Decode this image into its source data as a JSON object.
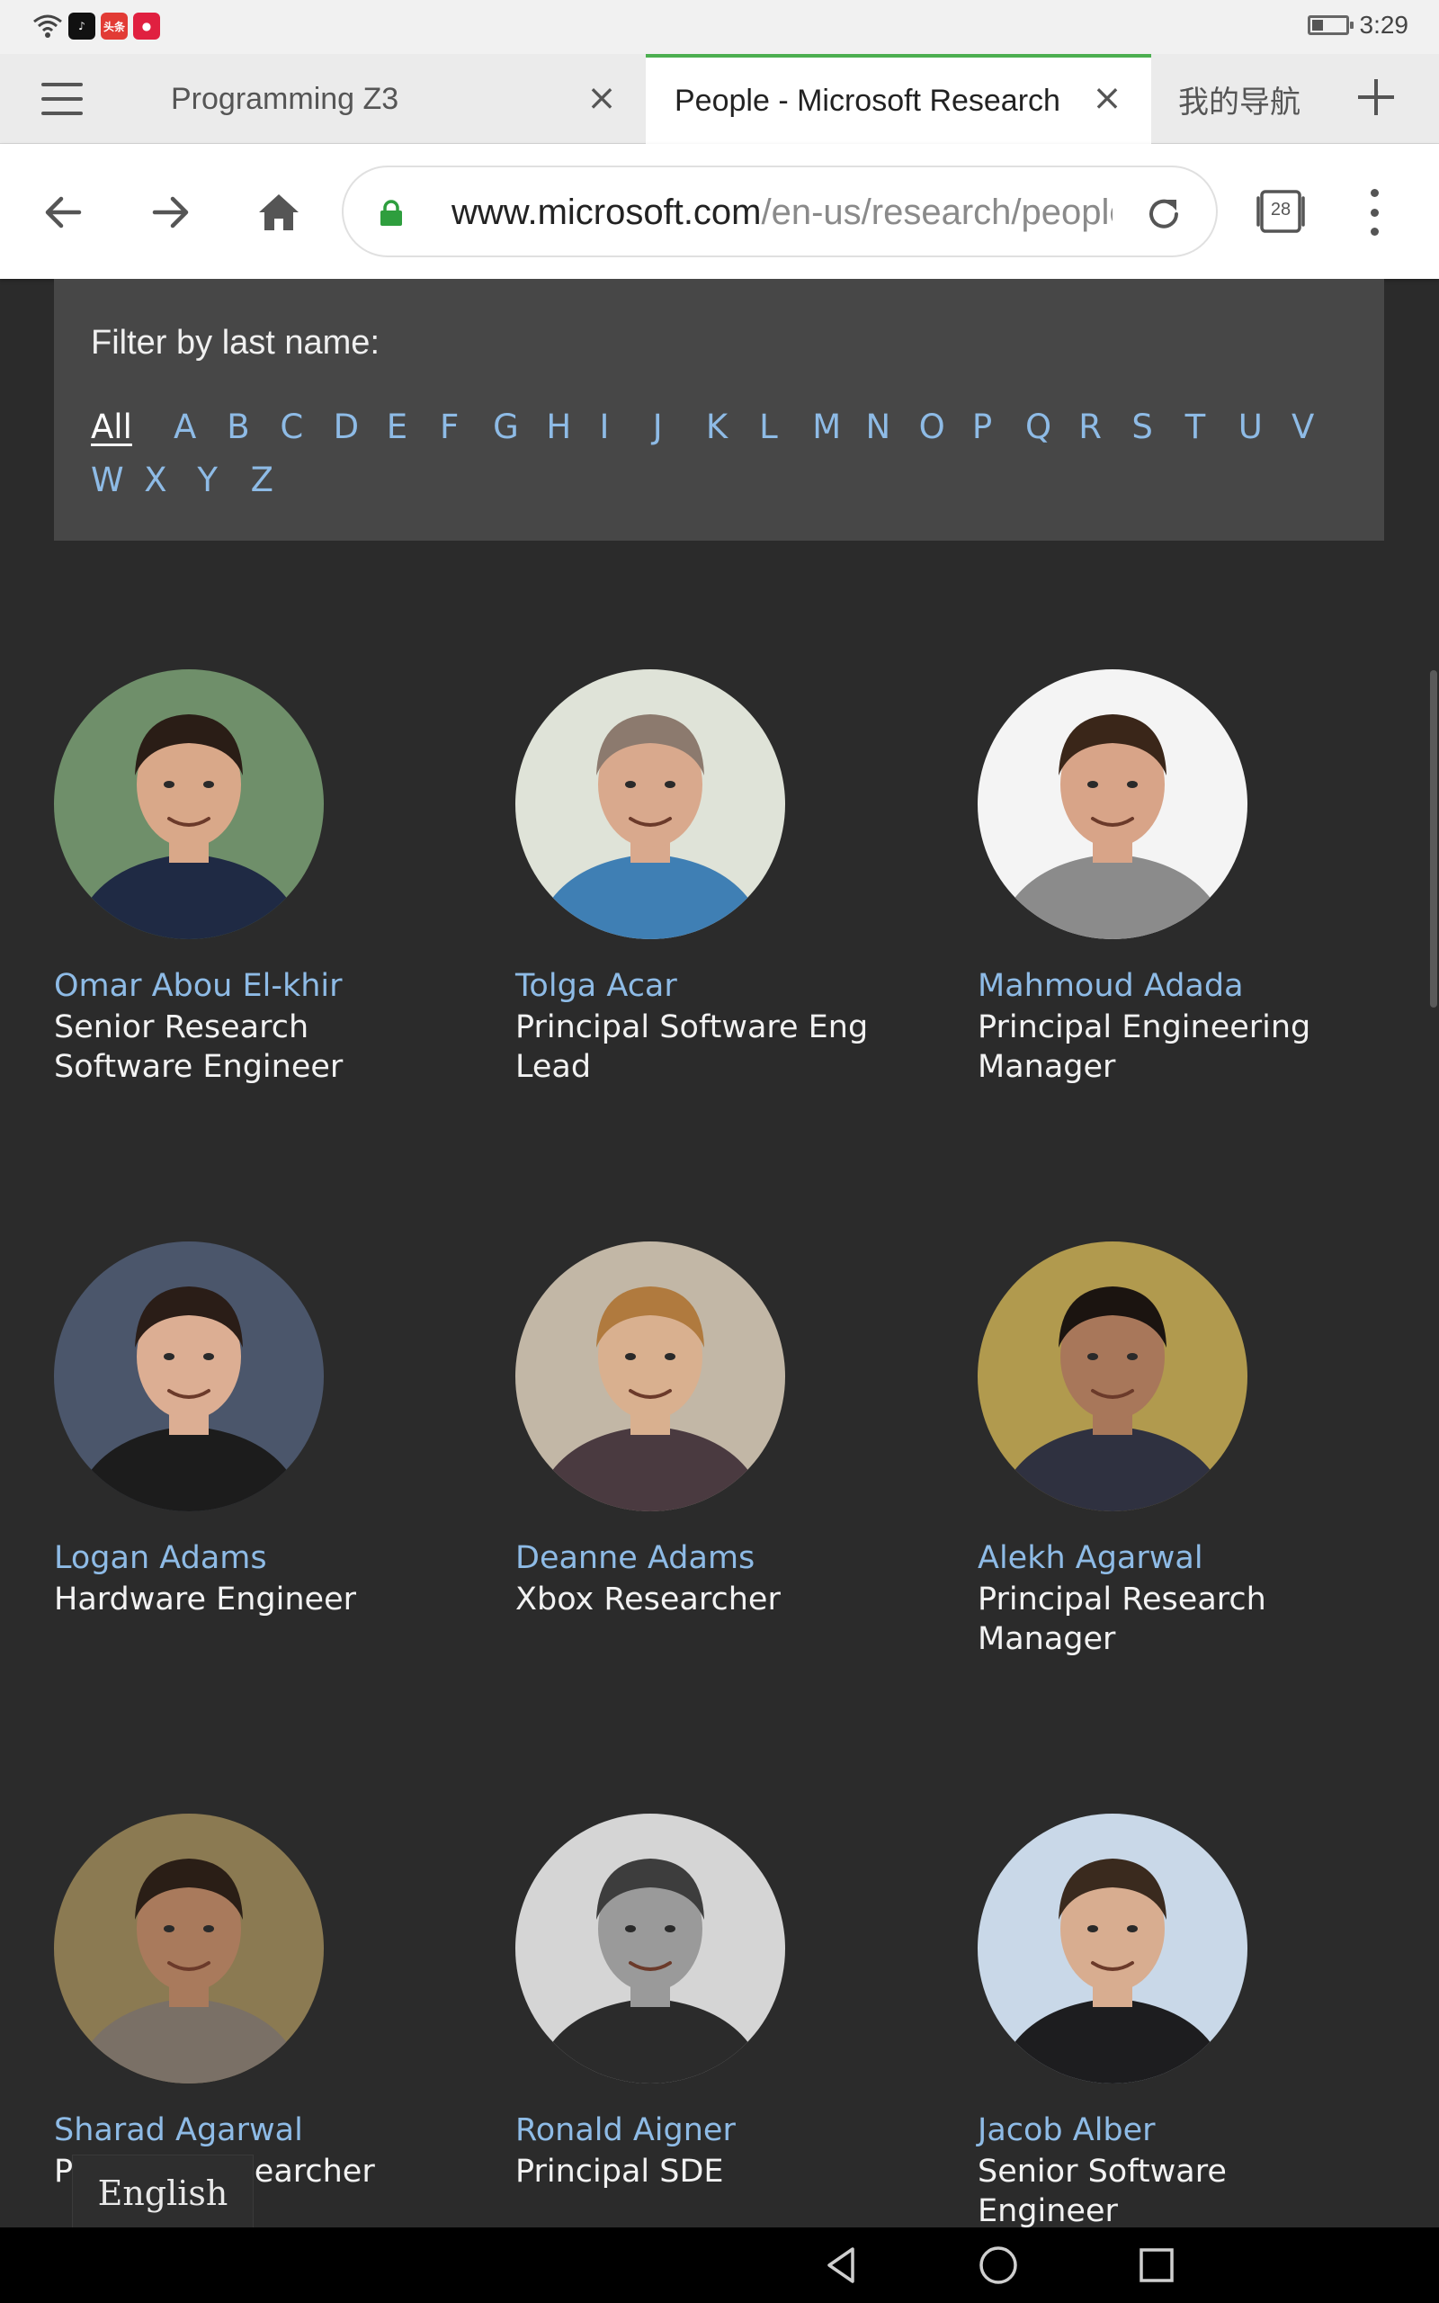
{
  "status_bar": {
    "time": "3:29",
    "apps": [
      {
        "name": "tiktok-app-icon",
        "label": "♪",
        "color": "#111111"
      },
      {
        "name": "toutiao-app-icon",
        "label": "头条",
        "color": "#e23b35"
      },
      {
        "name": "red-app-icon",
        "label": "●",
        "color": "#e02040"
      }
    ]
  },
  "browser": {
    "tabs": [
      {
        "label": "Programming Z3",
        "active": false
      },
      {
        "label": "People - Microsoft Research",
        "active": true
      },
      {
        "label": "我的导航",
        "active": false
      }
    ],
    "url_host": "www.microsoft.com",
    "url_path": "/en-us/research/people/",
    "tab_count": "28"
  },
  "filter": {
    "title": "Filter by last name:",
    "all_label": "All",
    "letters": [
      "A",
      "B",
      "C",
      "D",
      "E",
      "F",
      "G",
      "H",
      "I",
      "J",
      "K",
      "L",
      "M",
      "N",
      "O",
      "P",
      "Q",
      "R",
      "S",
      "T",
      "U",
      "V",
      "W",
      "X",
      "Y",
      "Z"
    ]
  },
  "people": [
    {
      "name": "Omar Abou El-khir",
      "title": "Senior Research Software Engineer",
      "skin": "#d9a889",
      "hair": "#2a1d16",
      "shirt": "#1f2a44",
      "bg": "#6f8f6a"
    },
    {
      "name": "Tolga Acar",
      "title": "Principal Software Eng Lead",
      "skin": "#d9a98d",
      "hair": "#8c7a6e",
      "shirt": "#3f7fb4",
      "bg": "#dfe3d8"
    },
    {
      "name": "Mahmoud Adada",
      "title": "Principal Engineering Manager",
      "skin": "#d8a488",
      "hair": "#3a2619",
      "shirt": "#8b8b8b",
      "bg": "#f4f4f4"
    },
    {
      "name": "Logan Adams",
      "title": "Hardware Engineer",
      "skin": "#dcae93",
      "hair": "#2a1d17",
      "shirt": "#1c1c1c",
      "bg": "#4b566b"
    },
    {
      "name": "Deanne Adams",
      "title": "Xbox Researcher",
      "skin": "#d9b08f",
      "hair": "#b07a3e",
      "shirt": "#4a3a40",
      "bg": "#c2b7a6"
    },
    {
      "name": "Alekh Agarwal",
      "title": "Principal Research Manager",
      "skin": "#a8775a",
      "hair": "#1b1410",
      "shirt": "#2f3140",
      "bg": "#b19a4e"
    },
    {
      "name": "Sharad Agarwal",
      "title": "Principal Researcher",
      "skin": "#a97a5c",
      "hair": "#2a1e16",
      "shirt": "#7a7066",
      "bg": "#8b7a52"
    },
    {
      "name": "Ronald Aigner",
      "title": "Principal SDE",
      "skin": "#9a9a9a",
      "hair": "#3d3d3d",
      "shirt": "#2b2b2b",
      "bg": "#d5d5d5"
    },
    {
      "name": "Jacob Alber",
      "title": "Senior Software Engineer",
      "skin": "#d8ad90",
      "hair": "#3a2a1e",
      "shirt": "#1d1d1f",
      "bg": "#c9d8e8"
    }
  ],
  "language": "English",
  "colors": {
    "page_bg": "#2b2b2b",
    "link": "#8ebbe6",
    "filter_bg": "#474747",
    "active_tab_accent": "#4caf50",
    "lock_green": "#2e9e3e"
  }
}
